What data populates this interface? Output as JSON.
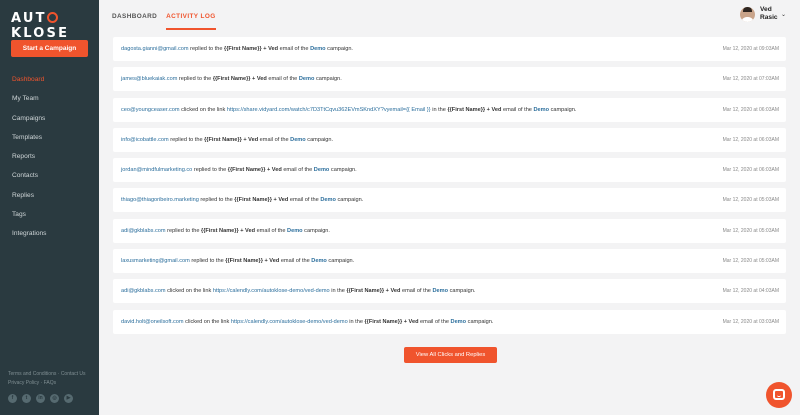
{
  "brand": {
    "logo_pre": "AUT",
    "logo_post": "KLOSE"
  },
  "sidebar": {
    "cta_label": "Start a Campaign",
    "items": [
      {
        "label": "Dashboard"
      },
      {
        "label": "My Team"
      },
      {
        "label": "Campaigns"
      },
      {
        "label": "Templates"
      },
      {
        "label": "Reports"
      },
      {
        "label": "Contacts"
      },
      {
        "label": "Replies"
      },
      {
        "label": "Tags"
      },
      {
        "label": "Integrations"
      }
    ],
    "footer": {
      "terms": "Terms and Conditions",
      "contact": "Contact Us",
      "privacy": "Privacy Policy",
      "faqs": "FAQs",
      "sep1": " · ",
      "sep2": " · "
    },
    "socials": [
      {
        "icon": "facebook-icon",
        "glyph": "f"
      },
      {
        "icon": "twitter-icon",
        "glyph": "t"
      },
      {
        "icon": "linkedin-icon",
        "glyph": "in"
      },
      {
        "icon": "instagram-icon",
        "glyph": "◎"
      },
      {
        "icon": "youtube-icon",
        "glyph": "▶"
      }
    ]
  },
  "header": {
    "tabs": [
      {
        "label": "DASHBOARD"
      },
      {
        "label": "ACTIVITY LOG"
      }
    ],
    "active_tab": "ACTIVITY LOG",
    "user": {
      "name": "Ved Rasic"
    }
  },
  "log": [
    {
      "who": "dagosta.gianni@gmail.com",
      "action": "replied to the",
      "link": "",
      "to": "",
      "mergetag": "{{First Name}}",
      "plus": "+",
      "sender": "Ved",
      "mid": "email of the",
      "campaign": "Demo",
      "tail": "campaign.",
      "time": "Mar 12, 2020 at 09:03AM"
    },
    {
      "who": "james@bluekaiak.com",
      "action": "replied to the",
      "link": "",
      "to": "",
      "mergetag": "{{First Name}}",
      "plus": "+",
      "sender": "Ved",
      "mid": "email of the",
      "campaign": "Demo",
      "tail": "campaign.",
      "time": "Mar 12, 2020 at 07:03AM"
    },
    {
      "who": "ceo@youngceaser.com",
      "action": "clicked on the link",
      "link": "https://share.vidyard.com/watch/c7D3TtCqvu362EVmSKndXY?vyemail={{ Email }}",
      "to": "in the",
      "mergetag": "{{First Name}}",
      "plus": "+",
      "sender": "Ved",
      "mid": "email of the",
      "campaign": "Demo",
      "tail": "campaign.",
      "time": "Mar 12, 2020 at 06:03AM"
    },
    {
      "who": "info@icobattle.com",
      "action": "replied to the",
      "link": "",
      "to": "",
      "mergetag": "{{First Name}}",
      "plus": "+",
      "sender": "Ved",
      "mid": "email of the",
      "campaign": "Demo",
      "tail": "campaign.",
      "time": "Mar 12, 2020 at 06:03AM"
    },
    {
      "who": "jordan@mindfulmarketing.co",
      "action": "replied to the",
      "link": "",
      "to": "",
      "mergetag": "{{First Name}}",
      "plus": "+",
      "sender": "Ved",
      "mid": "email of the",
      "campaign": "Demo",
      "tail": "campaign.",
      "time": "Mar 12, 2020 at 06:03AM"
    },
    {
      "who": "thiago@thiagoribeiro.marketing",
      "action": "replied to the",
      "link": "",
      "to": "",
      "mergetag": "{{First Name}}",
      "plus": "+",
      "sender": "Ved",
      "mid": "email of the",
      "campaign": "Demo",
      "tail": "campaign.",
      "time": "Mar 12, 2020 at 05:03AM"
    },
    {
      "who": "adi@gkblabs.com",
      "action": "replied to the",
      "link": "",
      "to": "",
      "mergetag": "{{First Name}}",
      "plus": "+",
      "sender": "Ved",
      "mid": "email of the",
      "campaign": "Demo",
      "tail": "campaign.",
      "time": "Mar 12, 2020 at 05:03AM"
    },
    {
      "who": "laxusmarketing@gmail.com",
      "action": "replied to the",
      "link": "",
      "to": "",
      "mergetag": "{{First Name}}",
      "plus": "+",
      "sender": "Ved",
      "mid": "email of the",
      "campaign": "Demo",
      "tail": "campaign.",
      "time": "Mar 12, 2020 at 05:03AM"
    },
    {
      "who": "adi@gkblabs.com",
      "action": "clicked on the link",
      "link": "https://calendly.com/autoklose-demo/ved-demo",
      "to": "in the",
      "mergetag": "{{First Name}}",
      "plus": "+",
      "sender": "Ved",
      "mid": "email of the",
      "campaign": "Demo",
      "tail": "campaign.",
      "time": "Mar 12, 2020 at 04:03AM"
    },
    {
      "who": "david.holt@oneilsoft.com",
      "action": "clicked on the link",
      "link": "https://calendly.com/autoklose-demo/ved-demo",
      "to": "in the",
      "mergetag": "{{First Name}}",
      "plus": "+",
      "sender": "Ved",
      "mid": "email of the",
      "campaign": "Demo",
      "tail": "campaign.",
      "time": "Mar 12, 2020 at 03:03AM"
    }
  ],
  "view_all_label": "View All Clicks and Replies",
  "colors": {
    "accent": "#f0542d",
    "sidebar": "#2a3a40",
    "link": "#2b6e9c",
    "background": "#f3f3f4"
  },
  "chat": {
    "icon": "chat-icon"
  }
}
